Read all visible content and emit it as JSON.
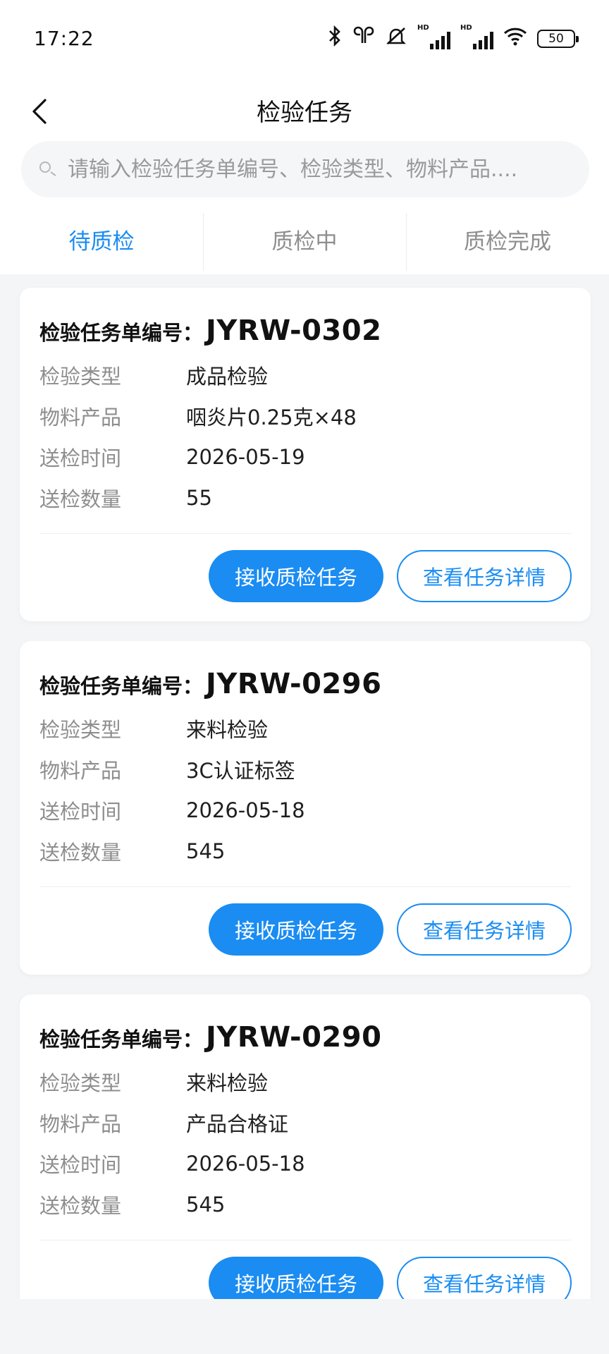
{
  "status_bar": {
    "time": "17:22",
    "battery": "50",
    "icons": [
      "bluetooth-icon",
      "earbuds-icon",
      "mute-icon",
      "signal-hd-icon",
      "signal-hd-icon",
      "wifi-icon",
      "battery-icon"
    ],
    "hd_label": "HD"
  },
  "nav": {
    "title": "检验任务",
    "back_icon": "chevron-left-icon"
  },
  "search": {
    "placeholder": "请输入检验任务单编号、检验类型、物料产品....",
    "icon": "search-icon"
  },
  "tabs": [
    {
      "label": "待质检",
      "active": true
    },
    {
      "label": "质检中",
      "active": false
    },
    {
      "label": "质检完成",
      "active": false
    }
  ],
  "field_labels": {
    "code": "检验任务单编号：",
    "type": "检验类型",
    "product": "物料产品",
    "time": "送检时间",
    "qty": "送检数量"
  },
  "buttons": {
    "accept": "接收质检任务",
    "detail": "查看任务详情"
  },
  "tasks": [
    {
      "code": "JYRW-0302",
      "type": "成品检验",
      "product": "咽炎片0.25克×48",
      "time": "2026-05-19",
      "qty": "55"
    },
    {
      "code": "JYRW-0296",
      "type": "来料检验",
      "product": "3C认证标签",
      "time": "2026-05-18",
      "qty": "545"
    },
    {
      "code": "JYRW-0290",
      "type": "来料检验",
      "product": "产品合格证",
      "time": "2026-05-18",
      "qty": "545"
    }
  ],
  "colors": {
    "accent": "#1a8cf2",
    "label": "#8e8e8e",
    "background": "#f4f5f7"
  }
}
